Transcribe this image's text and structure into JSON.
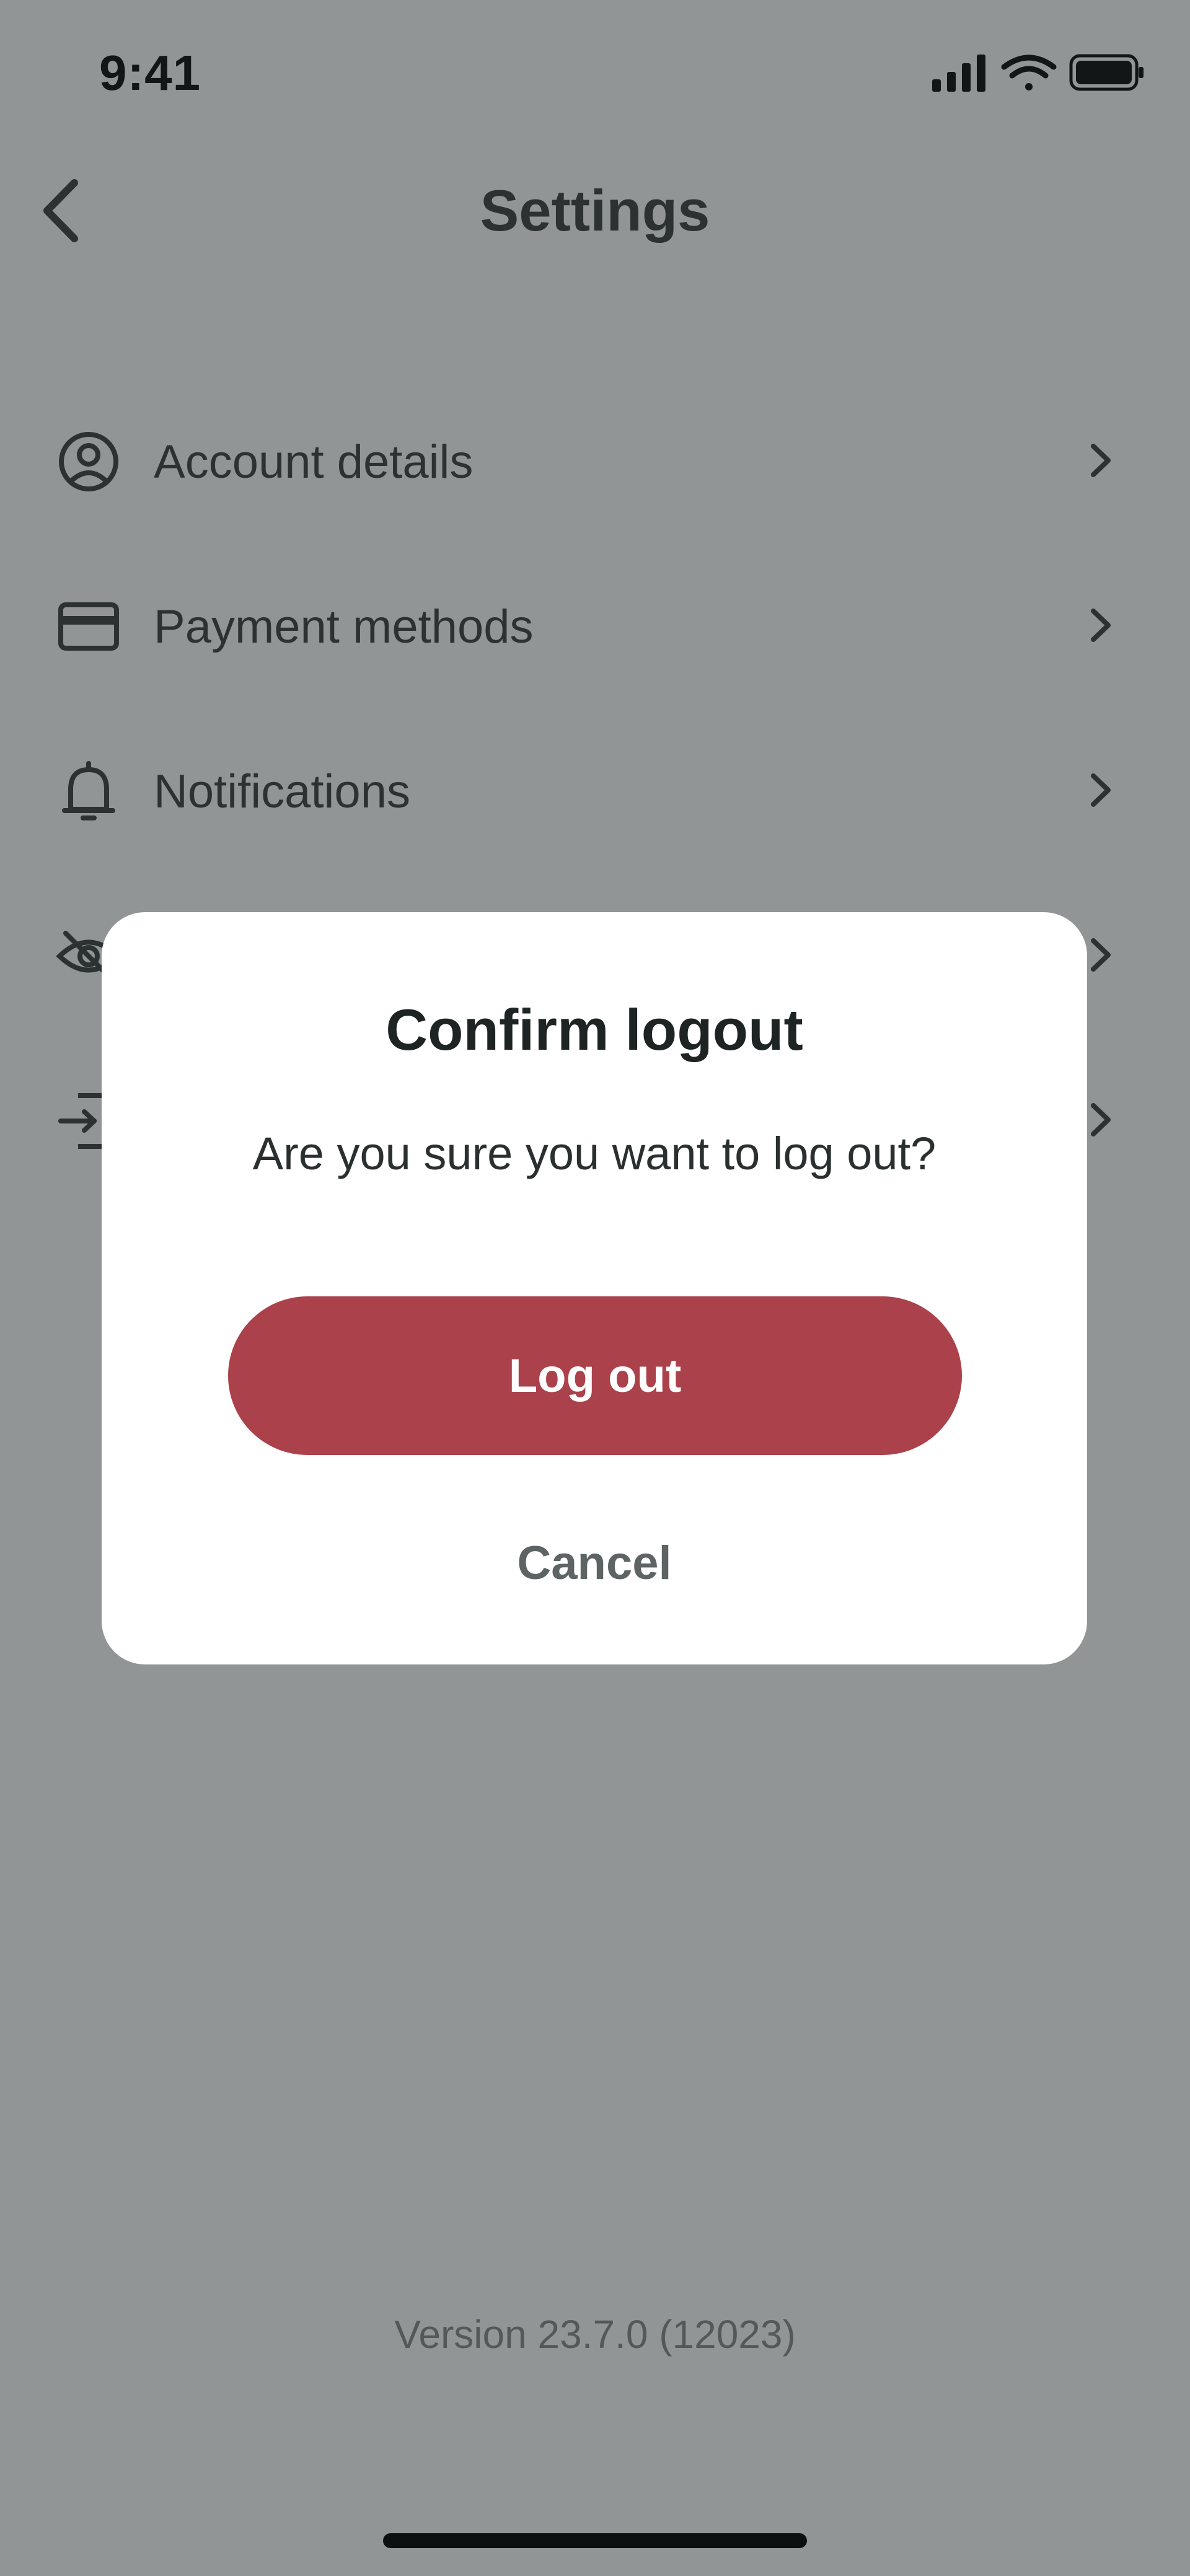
{
  "status_bar": {
    "time": "9:41",
    "icons": [
      "cellular-signal-icon",
      "wifi-icon",
      "battery-icon"
    ]
  },
  "header": {
    "title": "Settings",
    "back_icon": "chevron-left-icon"
  },
  "settings": {
    "items": [
      {
        "label": "Account details",
        "icon": "user-circle-icon"
      },
      {
        "label": "Payment methods",
        "icon": "credit-card-icon"
      },
      {
        "label": "Notifications",
        "icon": "bell-icon"
      },
      {
        "label": "",
        "icon": "eye-off-icon"
      },
      {
        "label": "",
        "icon": "logout-icon"
      }
    ],
    "chevron_icon": "chevron-right-icon"
  },
  "modal": {
    "title": "Confirm logout",
    "message": "Are you sure you want to log out?",
    "confirm_label": "Log out",
    "cancel_label": "Cancel"
  },
  "footer": {
    "version": "Version 23.7.0 (12023)"
  },
  "colors": {
    "overlay_background": "#919596",
    "danger": "#aa414b",
    "modal_background": "#ffffff"
  }
}
